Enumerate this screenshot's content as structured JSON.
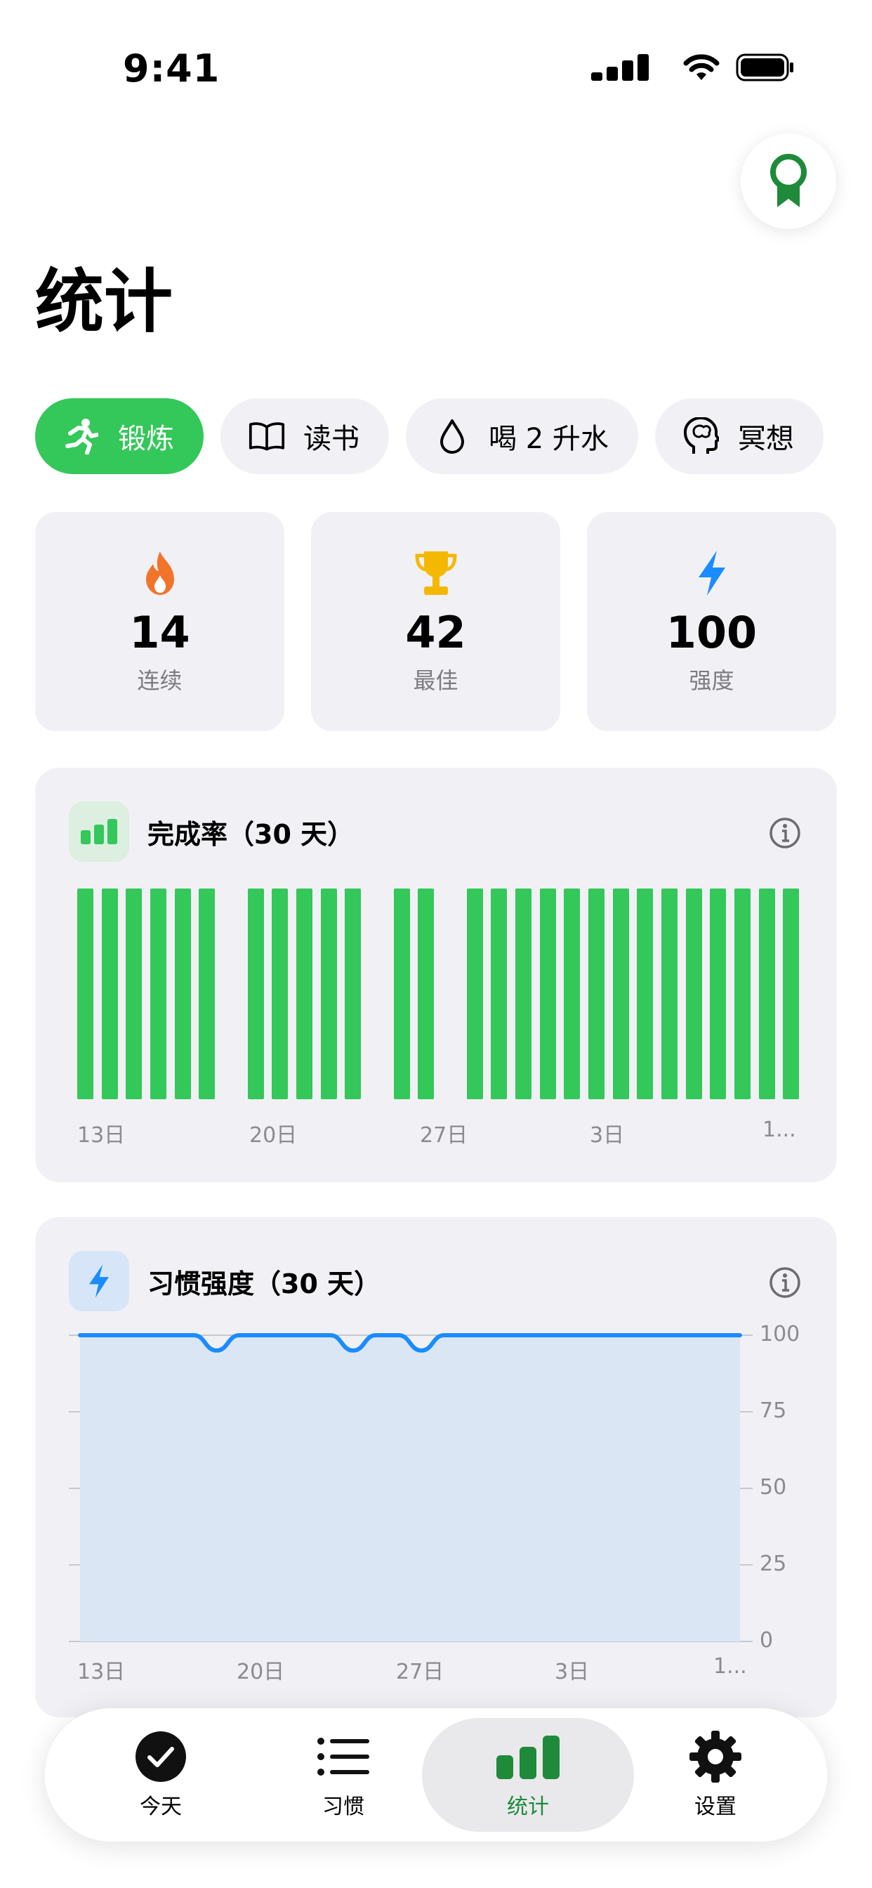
{
  "status_bar": {
    "time": "9:41"
  },
  "page": {
    "title": "统计"
  },
  "habits": [
    {
      "label": "锻炼",
      "icon": "running-figure-icon",
      "active": true
    },
    {
      "label": "读书",
      "icon": "open-book-icon",
      "active": false
    },
    {
      "label": "喝 2 升水",
      "icon": "water-drop-icon",
      "active": false
    },
    {
      "label": "冥想",
      "icon": "brain-head-icon",
      "active": false
    }
  ],
  "stats": [
    {
      "value": "14",
      "label": "连续",
      "icon": "flame-icon",
      "color": "#f2742b"
    },
    {
      "value": "42",
      "label": "最佳",
      "icon": "trophy-icon",
      "color": "#f5b800"
    },
    {
      "value": "100",
      "label": "强度",
      "icon": "bolt-icon",
      "color": "#1a8cff"
    }
  ],
  "completion": {
    "title": "完成率（30 天）",
    "x_labels": [
      "13日",
      "20日",
      "27日",
      "3日",
      "1..."
    ]
  },
  "strength": {
    "title": "习惯强度（30 天）",
    "x_labels": [
      "13日",
      "20日",
      "27日",
      "3日",
      "1..."
    ],
    "y_labels": [
      "100",
      "75",
      "50",
      "25",
      "0"
    ]
  },
  "chart_data": [
    {
      "type": "bar",
      "title": "完成率（30 天）",
      "x_tick_labels": [
        "13日",
        "20日",
        "27日",
        "3日",
        "1..."
      ],
      "values": [
        1,
        1,
        1,
        1,
        1,
        1,
        0,
        1,
        1,
        1,
        1,
        1,
        0,
        1,
        1,
        0,
        1,
        1,
        1,
        1,
        1,
        1,
        1,
        1,
        1,
        1,
        1,
        1,
        1,
        1
      ],
      "ylim": [
        0,
        1
      ],
      "color": "#34c759"
    },
    {
      "type": "area",
      "title": "习惯强度（30 天）",
      "x_tick_labels": [
        "13日",
        "20日",
        "27日",
        "3日",
        "1..."
      ],
      "y_ticks": [
        0,
        25,
        50,
        75,
        100
      ],
      "values": [
        100,
        100,
        100,
        100,
        100,
        100,
        95,
        100,
        100,
        100,
        100,
        100,
        95,
        100,
        100,
        95,
        100,
        100,
        100,
        100,
        100,
        100,
        100,
        100,
        100,
        100,
        100,
        100,
        100,
        100
      ],
      "ylim": [
        0,
        100
      ],
      "color": "#1a8cff",
      "fill": "#dbe6f5"
    }
  ],
  "tabbar": {
    "items": [
      {
        "label": "今天",
        "icon": "checkmark-circle-icon"
      },
      {
        "label": "习惯",
        "icon": "list-icon"
      },
      {
        "label": "统计",
        "icon": "bar-chart-icon",
        "active": true
      },
      {
        "label": "设置",
        "icon": "gear-icon"
      }
    ]
  },
  "colors": {
    "accent": "#34c759",
    "active_tab": "#1e8a3a",
    "strength": "#1a8cff"
  }
}
